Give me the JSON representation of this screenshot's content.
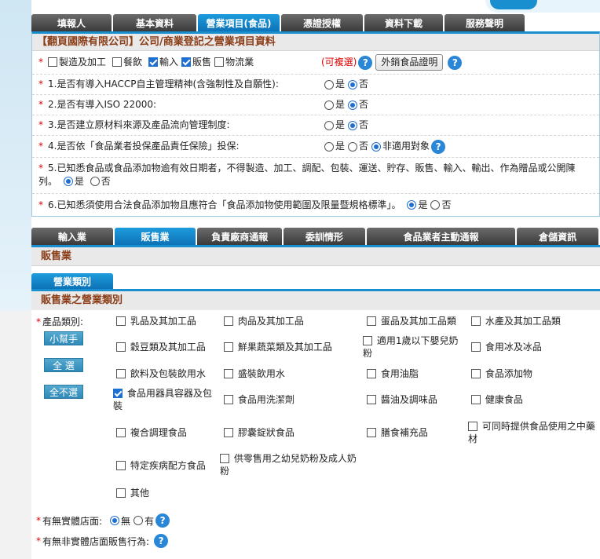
{
  "main_tabs": [
    "填報人",
    "基本資料",
    "營業項目(食品)",
    "憑證授權",
    "資料下載",
    "服務聲明"
  ],
  "main_tabs_active": 2,
  "panel_title": "【翻頁國際有限公司】公司/商業登記之營業項目資料",
  "business_types": [
    {
      "label": "製造及加工",
      "checked": false
    },
    {
      "label": "餐飲",
      "checked": false
    },
    {
      "label": "輸入",
      "checked": true
    },
    {
      "label": "販售",
      "checked": true
    },
    {
      "label": "物流業",
      "checked": false
    }
  ],
  "multi_select_note": "(可複選)",
  "export_button": "外銷食品證明",
  "questions": [
    {
      "text": "1.是否有導入HACCP自主管理精神(含強制性及自願性):",
      "options": [
        "是",
        "否"
      ],
      "selected": "否"
    },
    {
      "text": "2.是否有導入ISO 22000:",
      "options": [
        "是",
        "否"
      ],
      "selected": "否"
    },
    {
      "text": "3.是否建立原材料來源及產品流向管理制度:",
      "options": [
        "是",
        "否"
      ],
      "selected": "否"
    },
    {
      "text": "4.是否依「食品業者投保產品責任保險」投保:",
      "options": [
        "是",
        "否",
        "非適用對象"
      ],
      "selected": "非適用對象"
    }
  ],
  "q5": {
    "text_line1": "5.已知悉食品或食品添加物逾有效日期者，不得製造、加工、調配、包裝、運送、貯存、販售、輸入、輸出、作為贈品或公開陳",
    "text_line2": "列。",
    "options": [
      "是",
      "否"
    ],
    "selected": "是"
  },
  "q6": {
    "text": "6.已知悉須使用合法食品添加物且應符合「食品添加物使用範圍及限量暨規格標準」。",
    "options": [
      "是",
      "否"
    ],
    "selected": "是"
  },
  "sub_tabs": [
    "輸入業",
    "販售業",
    "負責廠商通報",
    "委訓情形",
    "食品業者主動通報",
    "倉儲資訊"
  ],
  "sub_tabs_active": 1,
  "sub_section_title": "販售業",
  "category_tab": "營業類別",
  "category_title": "販售業之營業類別",
  "product_label": "產品類別:",
  "side_buttons": [
    "小幫手",
    "全 選",
    "全不選"
  ],
  "product_items": [
    {
      "label": "乳品及其加工品",
      "checked": false
    },
    {
      "label": "肉品及其加工品",
      "checked": false
    },
    {
      "label": "蛋品及其加工品類",
      "checked": false
    },
    {
      "label": "水產及其加工品類",
      "checked": false
    },
    {
      "label": "穀豆類及其加工品",
      "checked": false
    },
    {
      "label": "鮮果蔬菜類及其加工品",
      "checked": false
    },
    {
      "label": "適用1歲以下嬰兒奶粉",
      "checked": false
    },
    {
      "label": "食用冰及冰品",
      "checked": false
    },
    {
      "label": "飲料及包裝飲用水",
      "checked": false
    },
    {
      "label": "盛裝飲用水",
      "checked": false
    },
    {
      "label": "食用油脂",
      "checked": false
    },
    {
      "label": "食品添加物",
      "checked": false
    },
    {
      "label": "食品用器具容器及包裝",
      "checked": true
    },
    {
      "label": "食品用洗潔劑",
      "checked": false
    },
    {
      "label": "醬油及調味品",
      "checked": false
    },
    {
      "label": "健康食品",
      "checked": false
    },
    {
      "label": "複合調理食品",
      "checked": false
    },
    {
      "label": "膠囊錠狀食品",
      "checked": false
    },
    {
      "label": "膳食補充品",
      "checked": false
    },
    {
      "label": "可同時提供食品使用之中藥材",
      "checked": false
    },
    {
      "label": "特定疾病配方食品",
      "checked": false
    },
    {
      "label": "供零售用之幼兒奶粉及成人奶粉",
      "checked": false
    },
    {
      "label": "其他",
      "checked": false
    }
  ],
  "physical_store": {
    "label": "有無實體店面:",
    "options": [
      "無",
      "有"
    ],
    "selected": "無"
  },
  "non_physical": {
    "label": "有無非實體店面販售行為:"
  }
}
